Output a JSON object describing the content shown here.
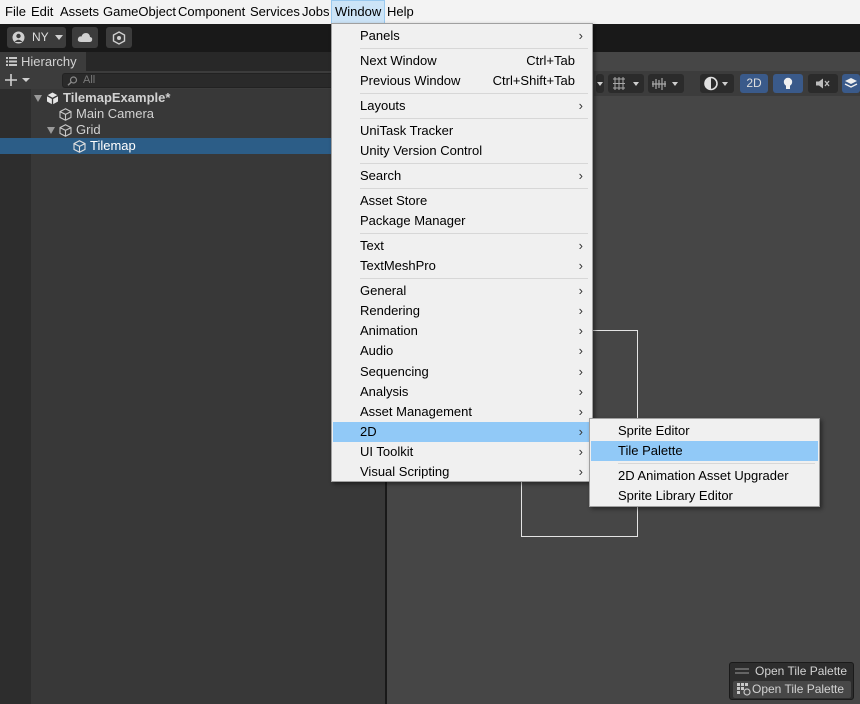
{
  "menubar": {
    "items": [
      "File",
      "Edit",
      "Assets",
      "GameObject",
      "Component",
      "Services",
      "Jobs",
      "Window",
      "Help"
    ],
    "active": "Window"
  },
  "toolbar": {
    "account_label": "NY",
    "account_icon": "account-icon",
    "cloud_icon": "cloud-icon",
    "collab_icon": "collab-icon"
  },
  "hierarchy": {
    "tab_label": "Hierarchy",
    "search_placeholder": "All",
    "rows": [
      {
        "label": "TilemapExample*",
        "icon": "unity-scene-icon",
        "expanded": true
      },
      {
        "label": "Main Camera",
        "icon": "gameobject-cube-icon"
      },
      {
        "label": "Grid",
        "icon": "gameobject-cube-icon",
        "expanded": true
      },
      {
        "label": "Tilemap",
        "icon": "gameobject-cube-icon",
        "selected": true
      }
    ]
  },
  "scene": {
    "toggle_2d": "2D",
    "overlay": {
      "title": "Open Tile Palette",
      "button": "Open Tile Palette"
    }
  },
  "window_menu": {
    "items": [
      {
        "label": "Panels",
        "submenu": true
      },
      {
        "label": "Next Window",
        "shortcut": "Ctrl+Tab"
      },
      {
        "label": "Previous Window",
        "shortcut": "Ctrl+Shift+Tab"
      },
      {
        "label": "Layouts",
        "submenu": true
      },
      {
        "label": "UniTask Tracker"
      },
      {
        "label": "Unity Version Control"
      },
      {
        "label": "Search",
        "submenu": true
      },
      {
        "label": "Asset Store"
      },
      {
        "label": "Package Manager"
      },
      {
        "label": "Text",
        "submenu": true
      },
      {
        "label": "TextMeshPro",
        "submenu": true
      },
      {
        "label": "General",
        "submenu": true
      },
      {
        "label": "Rendering",
        "submenu": true
      },
      {
        "label": "Animation",
        "submenu": true
      },
      {
        "label": "Audio",
        "submenu": true
      },
      {
        "label": "Sequencing",
        "submenu": true
      },
      {
        "label": "Analysis",
        "submenu": true
      },
      {
        "label": "Asset Management",
        "submenu": true
      },
      {
        "label": "2D",
        "submenu": true,
        "highlighted": true
      },
      {
        "label": "UI Toolkit",
        "submenu": true
      },
      {
        "label": "Visual Scripting",
        "submenu": true
      }
    ]
  },
  "submenu_2d": {
    "items": [
      {
        "label": "Sprite Editor"
      },
      {
        "label": "Tile Palette",
        "highlighted": true
      },
      {
        "label": "2D Animation Asset Upgrader"
      },
      {
        "label": "Sprite Library Editor"
      }
    ]
  },
  "colors": {
    "menu_highlight": "#91c9f7",
    "selection": "#2c5d87",
    "accent_2d": "#3a5a8a"
  }
}
